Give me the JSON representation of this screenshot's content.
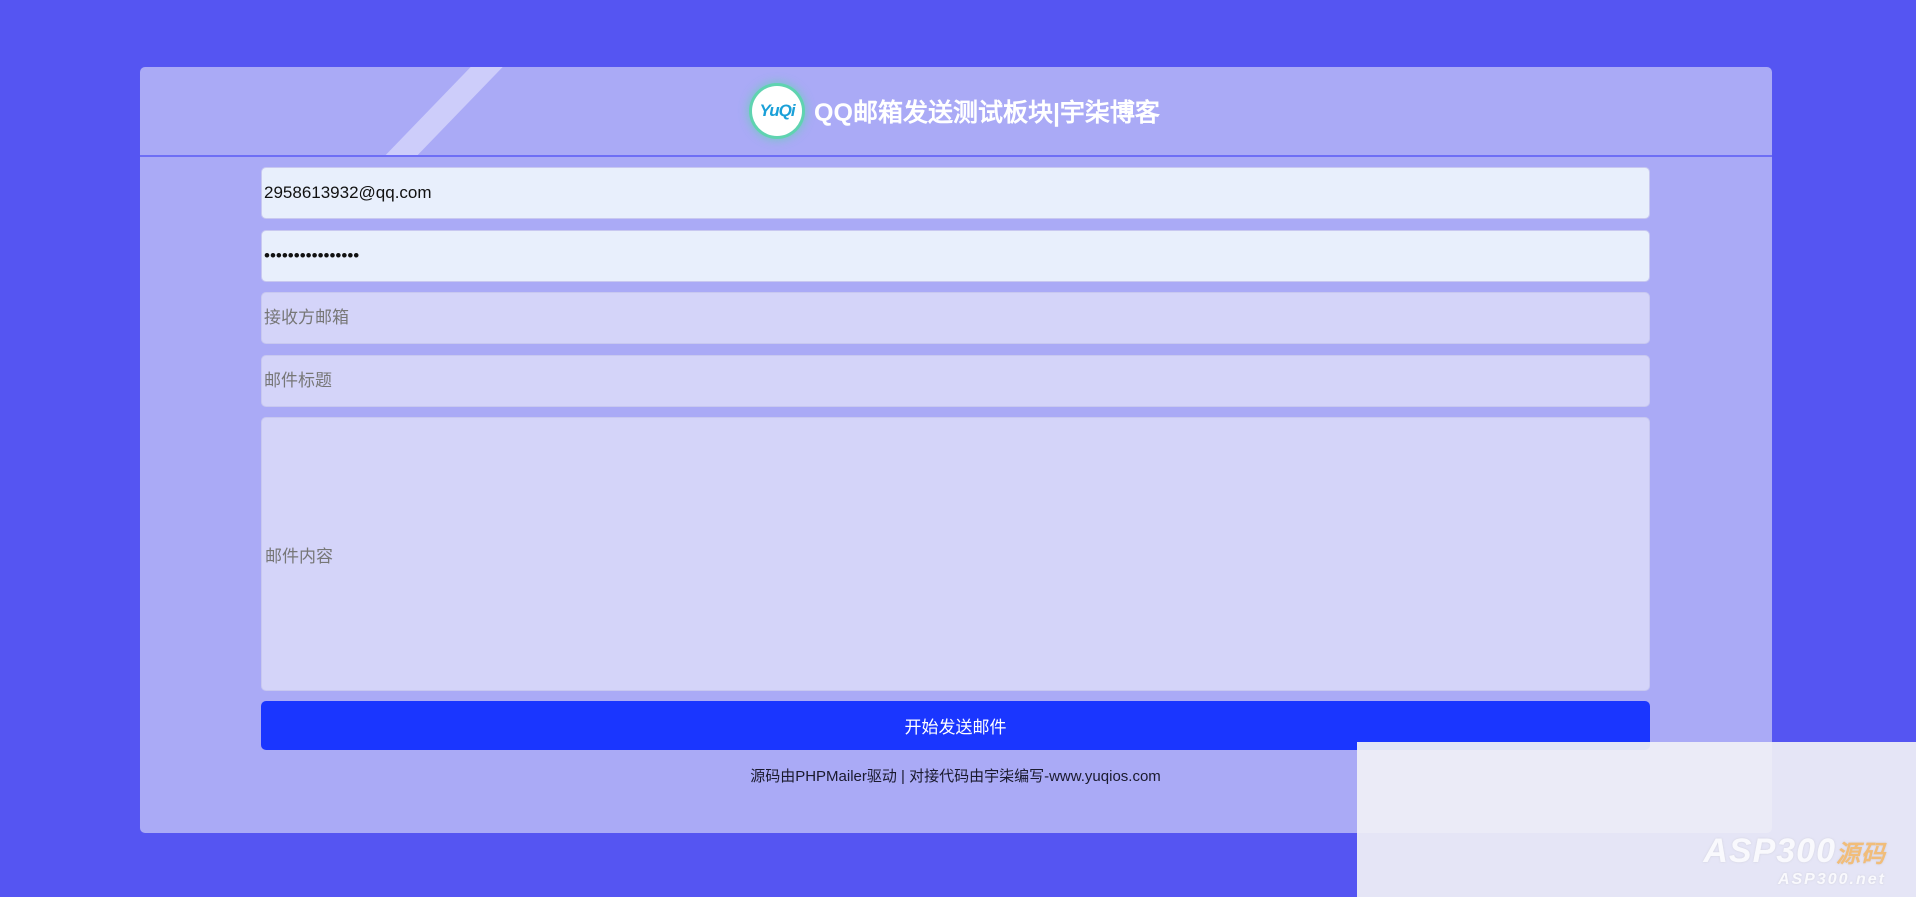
{
  "header": {
    "logo_text": "YuQi",
    "title": "QQ邮箱发送测试板块|宇柒博客"
  },
  "form": {
    "sender_email": {
      "value": "2958613932@qq.com"
    },
    "sender_password": {
      "value": "1234567890abcdef"
    },
    "recipient": {
      "placeholder": "接收方邮箱"
    },
    "subject": {
      "placeholder": "邮件标题"
    },
    "content": {
      "placeholder": "邮件内容"
    },
    "send_label": "开始发送邮件"
  },
  "footer": {
    "text": "源码由PHPMailer驱动 | 对接代码由宇柒编写-www.yuqios.com"
  },
  "watermark": {
    "main": "ASP300",
    "suffix": "源码",
    "sub": "ASP300.net"
  },
  "colors": {
    "page_bg": "#5555f2",
    "card_bg": "#aaaaf6",
    "button_bg": "#1a36ff",
    "logo_ring": "#5fd3b0"
  }
}
